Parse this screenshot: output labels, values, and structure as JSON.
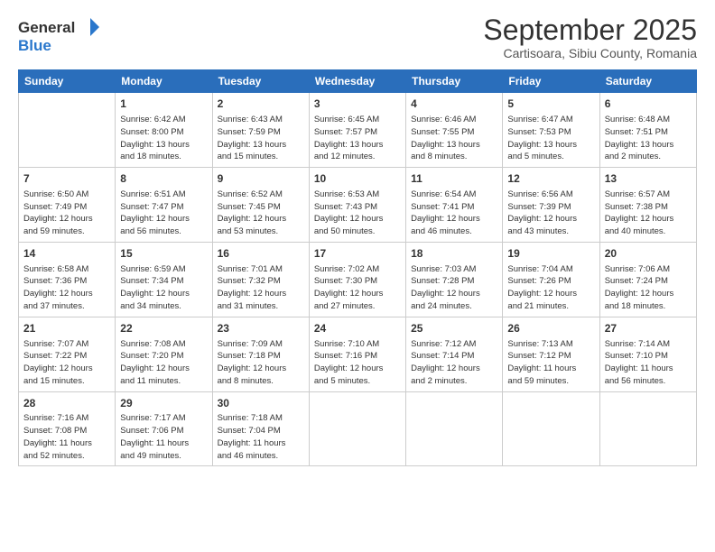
{
  "header": {
    "logo_general": "General",
    "logo_blue": "Blue",
    "month": "September 2025",
    "location": "Cartisoara, Sibiu County, Romania"
  },
  "days_of_week": [
    "Sunday",
    "Monday",
    "Tuesday",
    "Wednesday",
    "Thursday",
    "Friday",
    "Saturday"
  ],
  "weeks": [
    [
      {
        "day": "",
        "info": ""
      },
      {
        "day": "1",
        "info": "Sunrise: 6:42 AM\nSunset: 8:00 PM\nDaylight: 13 hours\nand 18 minutes."
      },
      {
        "day": "2",
        "info": "Sunrise: 6:43 AM\nSunset: 7:59 PM\nDaylight: 13 hours\nand 15 minutes."
      },
      {
        "day": "3",
        "info": "Sunrise: 6:45 AM\nSunset: 7:57 PM\nDaylight: 13 hours\nand 12 minutes."
      },
      {
        "day": "4",
        "info": "Sunrise: 6:46 AM\nSunset: 7:55 PM\nDaylight: 13 hours\nand 8 minutes."
      },
      {
        "day": "5",
        "info": "Sunrise: 6:47 AM\nSunset: 7:53 PM\nDaylight: 13 hours\nand 5 minutes."
      },
      {
        "day": "6",
        "info": "Sunrise: 6:48 AM\nSunset: 7:51 PM\nDaylight: 13 hours\nand 2 minutes."
      }
    ],
    [
      {
        "day": "7",
        "info": "Sunrise: 6:50 AM\nSunset: 7:49 PM\nDaylight: 12 hours\nand 59 minutes."
      },
      {
        "day": "8",
        "info": "Sunrise: 6:51 AM\nSunset: 7:47 PM\nDaylight: 12 hours\nand 56 minutes."
      },
      {
        "day": "9",
        "info": "Sunrise: 6:52 AM\nSunset: 7:45 PM\nDaylight: 12 hours\nand 53 minutes."
      },
      {
        "day": "10",
        "info": "Sunrise: 6:53 AM\nSunset: 7:43 PM\nDaylight: 12 hours\nand 50 minutes."
      },
      {
        "day": "11",
        "info": "Sunrise: 6:54 AM\nSunset: 7:41 PM\nDaylight: 12 hours\nand 46 minutes."
      },
      {
        "day": "12",
        "info": "Sunrise: 6:56 AM\nSunset: 7:39 PM\nDaylight: 12 hours\nand 43 minutes."
      },
      {
        "day": "13",
        "info": "Sunrise: 6:57 AM\nSunset: 7:38 PM\nDaylight: 12 hours\nand 40 minutes."
      }
    ],
    [
      {
        "day": "14",
        "info": "Sunrise: 6:58 AM\nSunset: 7:36 PM\nDaylight: 12 hours\nand 37 minutes."
      },
      {
        "day": "15",
        "info": "Sunrise: 6:59 AM\nSunset: 7:34 PM\nDaylight: 12 hours\nand 34 minutes."
      },
      {
        "day": "16",
        "info": "Sunrise: 7:01 AM\nSunset: 7:32 PM\nDaylight: 12 hours\nand 31 minutes."
      },
      {
        "day": "17",
        "info": "Sunrise: 7:02 AM\nSunset: 7:30 PM\nDaylight: 12 hours\nand 27 minutes."
      },
      {
        "day": "18",
        "info": "Sunrise: 7:03 AM\nSunset: 7:28 PM\nDaylight: 12 hours\nand 24 minutes."
      },
      {
        "day": "19",
        "info": "Sunrise: 7:04 AM\nSunset: 7:26 PM\nDaylight: 12 hours\nand 21 minutes."
      },
      {
        "day": "20",
        "info": "Sunrise: 7:06 AM\nSunset: 7:24 PM\nDaylight: 12 hours\nand 18 minutes."
      }
    ],
    [
      {
        "day": "21",
        "info": "Sunrise: 7:07 AM\nSunset: 7:22 PM\nDaylight: 12 hours\nand 15 minutes."
      },
      {
        "day": "22",
        "info": "Sunrise: 7:08 AM\nSunset: 7:20 PM\nDaylight: 12 hours\nand 11 minutes."
      },
      {
        "day": "23",
        "info": "Sunrise: 7:09 AM\nSunset: 7:18 PM\nDaylight: 12 hours\nand 8 minutes."
      },
      {
        "day": "24",
        "info": "Sunrise: 7:10 AM\nSunset: 7:16 PM\nDaylight: 12 hours\nand 5 minutes."
      },
      {
        "day": "25",
        "info": "Sunrise: 7:12 AM\nSunset: 7:14 PM\nDaylight: 12 hours\nand 2 minutes."
      },
      {
        "day": "26",
        "info": "Sunrise: 7:13 AM\nSunset: 7:12 PM\nDaylight: 11 hours\nand 59 minutes."
      },
      {
        "day": "27",
        "info": "Sunrise: 7:14 AM\nSunset: 7:10 PM\nDaylight: 11 hours\nand 56 minutes."
      }
    ],
    [
      {
        "day": "28",
        "info": "Sunrise: 7:16 AM\nSunset: 7:08 PM\nDaylight: 11 hours\nand 52 minutes."
      },
      {
        "day": "29",
        "info": "Sunrise: 7:17 AM\nSunset: 7:06 PM\nDaylight: 11 hours\nand 49 minutes."
      },
      {
        "day": "30",
        "info": "Sunrise: 7:18 AM\nSunset: 7:04 PM\nDaylight: 11 hours\nand 46 minutes."
      },
      {
        "day": "",
        "info": ""
      },
      {
        "day": "",
        "info": ""
      },
      {
        "day": "",
        "info": ""
      },
      {
        "day": "",
        "info": ""
      }
    ]
  ]
}
